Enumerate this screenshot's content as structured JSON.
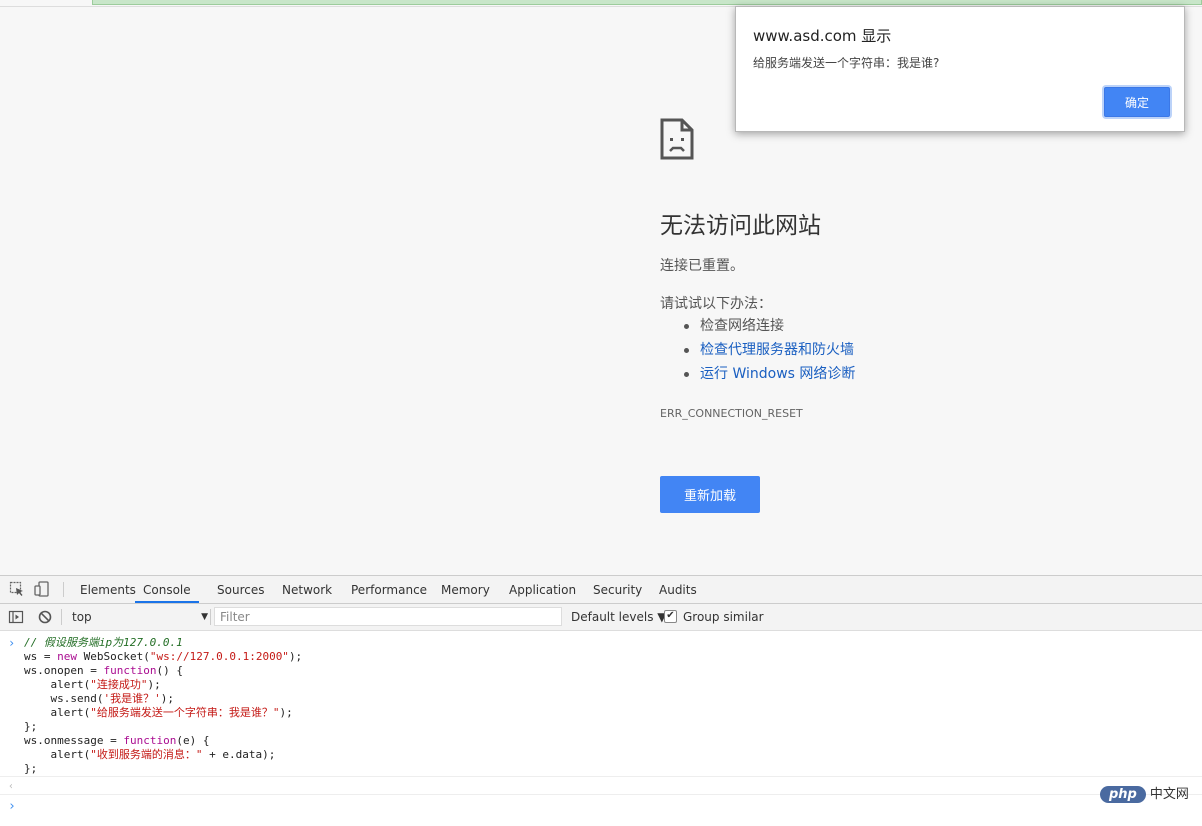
{
  "dialog": {
    "title": "www.asd.com 显示",
    "message": "给服务端发送一个字符串：我是谁?",
    "ok_label": "确定"
  },
  "error_page": {
    "title": "无法访问此网站",
    "subtitle": "连接已重置。",
    "try_label": "请试试以下办法：",
    "suggestions": [
      {
        "label": "检查网络连接",
        "is_link": false
      },
      {
        "label": "检查代理服务器和防火墙",
        "is_link": true
      },
      {
        "label": "运行 Windows 网络诊断",
        "is_link": true
      }
    ],
    "error_code": "ERR_CONNECTION_RESET",
    "reload_label": "重新加载",
    "icon": "sad-page-icon"
  },
  "devtools": {
    "tabs": [
      "Elements",
      "Console",
      "Sources",
      "Network",
      "Performance",
      "Memory",
      "Application",
      "Security",
      "Audits"
    ],
    "active_tab": "Console",
    "toolbar": {
      "context": "top",
      "filter_placeholder": "Filter",
      "levels": "Default levels ▼",
      "group_similar": "Group similar",
      "group_checked": true
    },
    "console_lines": [
      "// 假设服务端ip为127.0.0.1",
      "ws = new WebSocket(\"ws://127.0.0.1:2000\");",
      "ws.onopen = function() {",
      "    alert(\"连接成功\");",
      "    ws.send('我是谁？');",
      "    alert(\"给服务端发送一个字符串：我是谁？\");",
      "};",
      "ws.onmessage = function(e) {",
      "    alert(\"收到服务端的消息：\" + e.data);",
      "};"
    ]
  },
  "watermark": {
    "badge": "php",
    "text": "中文网"
  },
  "colors": {
    "accent_blue": "#4285f4",
    "link_blue": "#1a5fc1",
    "page_bg": "#f7f7f7"
  }
}
